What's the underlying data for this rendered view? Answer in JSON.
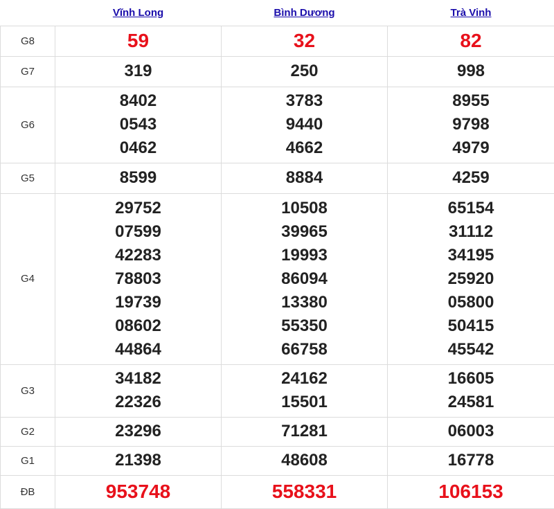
{
  "provinces": [
    {
      "name": "Vĩnh Long"
    },
    {
      "name": "Bình Dương"
    },
    {
      "name": "Trà Vinh"
    }
  ],
  "prizes": [
    {
      "label": "G8",
      "results": [
        [
          "59"
        ],
        [
          "32"
        ],
        [
          "82"
        ]
      ]
    },
    {
      "label": "G7",
      "results": [
        [
          "319"
        ],
        [
          "250"
        ],
        [
          "998"
        ]
      ]
    },
    {
      "label": "G6",
      "results": [
        [
          "8402",
          "0543",
          "0462"
        ],
        [
          "3783",
          "9440",
          "4662"
        ],
        [
          "8955",
          "9798",
          "4979"
        ]
      ]
    },
    {
      "label": "G5",
      "results": [
        [
          "8599"
        ],
        [
          "8884"
        ],
        [
          "4259"
        ]
      ]
    },
    {
      "label": "G4",
      "results": [
        [
          "29752",
          "07599",
          "42283",
          "78803",
          "19739",
          "08602",
          "44864"
        ],
        [
          "10508",
          "39965",
          "19993",
          "86094",
          "13380",
          "55350",
          "66758"
        ],
        [
          "65154",
          "31112",
          "34195",
          "25920",
          "05800",
          "50415",
          "45542"
        ]
      ]
    },
    {
      "label": "G3",
      "results": [
        [
          "34182",
          "22326"
        ],
        [
          "24162",
          "15501"
        ],
        [
          "16605",
          "24581"
        ]
      ]
    },
    {
      "label": "G2",
      "results": [
        [
          "23296"
        ],
        [
          "71281"
        ],
        [
          "06003"
        ]
      ]
    },
    {
      "label": "G1",
      "results": [
        [
          "21398"
        ],
        [
          "48608"
        ],
        [
          "16778"
        ]
      ]
    },
    {
      "label": "ĐB",
      "results": [
        [
          "953748"
        ],
        [
          "558331"
        ],
        [
          "106153"
        ]
      ]
    }
  ],
  "colors": {
    "link": "#1a0dab",
    "special_number": "#e8111b",
    "number": "#222222",
    "grid": "#dcdcdc"
  }
}
